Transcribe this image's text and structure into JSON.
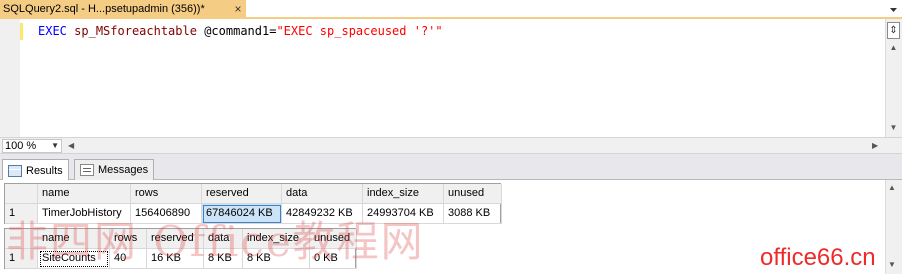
{
  "document_tab": {
    "title": "SQLQuery2.sql - H...psetupadmin (356))*",
    "close": "×"
  },
  "editor": {
    "code": {
      "kw1": "EXEC",
      "proc": "sp_MSforeachtable",
      "param": "@command1=",
      "str": "\"EXEC sp_spaceused '?'\""
    }
  },
  "zoom": {
    "value": "100 %"
  },
  "result_tabs": [
    {
      "label": "Results",
      "icon": "grid-icon"
    },
    {
      "label": "Messages",
      "icon": "messages-icon"
    }
  ],
  "grid1": {
    "columns": [
      "name",
      "rows",
      "reserved",
      "data",
      "index_size",
      "unused"
    ],
    "rows": [
      {
        "num": "1",
        "cells": [
          "TimerJobHistory",
          "156406890",
          "67846024 KB",
          "42849232 KB",
          "24993704 KB",
          "3088 KB"
        ]
      }
    ]
  },
  "grid2": {
    "columns": [
      "name",
      "rows",
      "reserved",
      "data",
      "index_size",
      "unused"
    ],
    "rows": [
      {
        "num": "1",
        "cells": [
          "SiteCounts",
          "40",
          "16 KB",
          "8 KB",
          "8 KB",
          "0 KB"
        ]
      }
    ]
  },
  "watermark": {
    "chinese": "非四网 Office教程网",
    "site": "office66.cn"
  }
}
